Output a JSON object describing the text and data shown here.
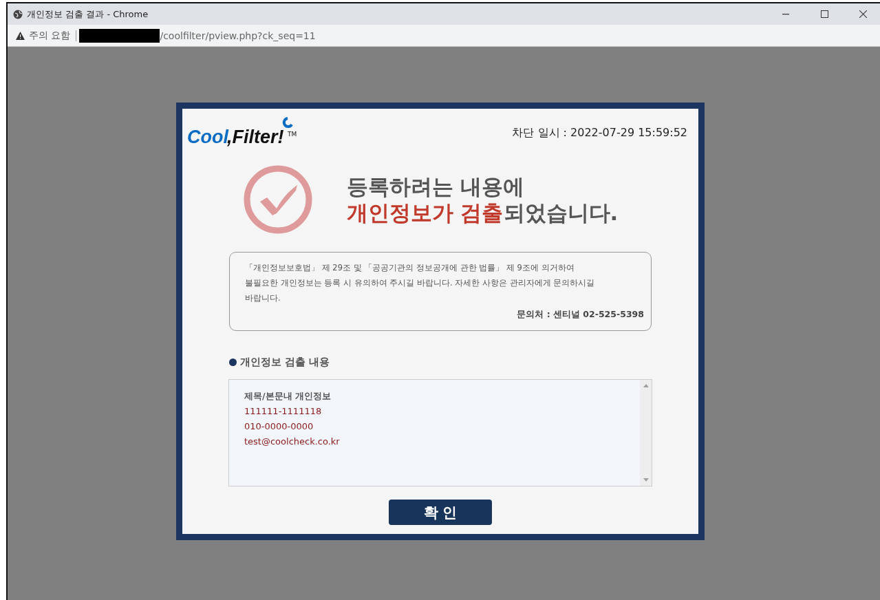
{
  "window": {
    "title": "개인정보 검출 결과 - Chrome",
    "security_label": "주의 요함",
    "url": "/coolfilter/pview.php?ck_seq=11"
  },
  "dialog": {
    "logo": {
      "part_1": "Cool",
      "part_2": ",Filter!",
      "mark": "TM"
    },
    "blocked_at": "차단 일시 : 2022-07-29 15:59:52",
    "headline": {
      "line_1": "등록하려는 내용에",
      "highlight": "개인정보가 검출",
      "rest": "되었습니다."
    },
    "notice": {
      "lines": [
        "「개인정보보호법」 제 29조 및 「공공기관의 정보공개에 관한 법률」 제 9조에 의거하여",
        "불필요한 개인정보는 등록 시 유의하여 주시길 바랍니다. 자세한 사항은 관리자에게 문의하시길",
        "바랍니다."
      ],
      "contact": "문의처 : 센티널 02-525-5398"
    },
    "section_title": "개인정보 검출 내용",
    "detected": {
      "heading": "제목/본문내 개인정보",
      "items": [
        "111111-1111118",
        "010-0000-0000",
        "test@coolcheck.co.kr"
      ]
    },
    "confirm_button": "확인"
  }
}
